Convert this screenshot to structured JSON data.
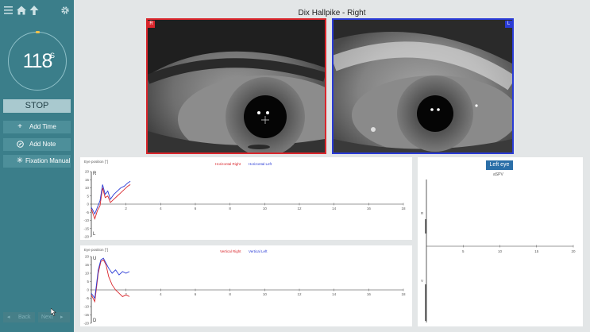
{
  "sidebar": {
    "icons": [
      "menu-icon",
      "home-icon",
      "upload-arrow-icon",
      "gear-icon"
    ],
    "timer": {
      "value": "118",
      "unit": "S"
    },
    "stop_label": "STOP",
    "buttons": [
      {
        "icon": "plus-icon",
        "label": "Add Time"
      },
      {
        "icon": "pencil-icon",
        "label": "Add Note"
      },
      {
        "icon": "fixation-icon",
        "label": "Fixation Manual"
      }
    ],
    "nav": {
      "back": "Back",
      "next": "Next"
    }
  },
  "header": {
    "title": "Dix Hallpike - Right"
  },
  "cameras": [
    {
      "label": "R",
      "border": "#d9262c"
    },
    {
      "label": "L",
      "border": "#2a3bd6"
    }
  ],
  "charts": {
    "ylabel": "Eye position [°]",
    "top_plot": {
      "legend": [
        "Horizontal Right",
        "Horizontal Left"
      ],
      "y_top_label": "R",
      "y_bottom_label": "L"
    },
    "bottom_plot": {
      "legend": [
        "Vertical Right",
        "Vertical Left"
      ],
      "y_top_label": "U",
      "y_bottom_label": "D"
    },
    "right_color": "#d9262c",
    "left_color": "#2a3bd6"
  },
  "spv": {
    "button": "Left eye",
    "title": "aSPV",
    "right_axis_top": "R",
    "right_axis_bottom": "V"
  },
  "chart_data": [
    {
      "type": "line",
      "xlim": [
        0,
        18
      ],
      "ylim": [
        -20,
        20
      ],
      "x_ticks": [
        2,
        4,
        6,
        8,
        10,
        12,
        14,
        16,
        18
      ],
      "y_ticks": [
        20,
        15,
        10,
        5,
        0,
        -5,
        -10,
        -15,
        -20
      ],
      "series": [
        {
          "name": "Horizontal Right",
          "x": [
            0,
            0.2,
            0.35,
            0.5,
            0.65,
            0.8,
            0.95,
            1.1,
            1.3,
            1.5,
            1.7,
            1.9,
            2.1,
            2.25
          ],
          "y": [
            -3,
            -9,
            -4,
            -1,
            10,
            4,
            5,
            1,
            3,
            5,
            7,
            9,
            11,
            12
          ]
        },
        {
          "name": "Horizontal Left",
          "x": [
            0,
            0.2,
            0.35,
            0.5,
            0.65,
            0.8,
            0.95,
            1.1,
            1.3,
            1.5,
            1.7,
            1.9,
            2.1,
            2.25
          ],
          "y": [
            -2,
            -6,
            -2,
            2,
            12,
            6,
            8,
            3,
            6,
            8,
            10,
            11,
            13,
            14
          ]
        }
      ]
    },
    {
      "type": "line",
      "xlim": [
        0,
        18
      ],
      "ylim": [
        -20,
        20
      ],
      "x_ticks": [
        2,
        4,
        6,
        8,
        10,
        12,
        14,
        16,
        18
      ],
      "y_ticks": [
        20,
        15,
        10,
        5,
        0,
        -5,
        -10,
        -15,
        -20
      ],
      "series": [
        {
          "name": "Vertical Right",
          "x": [
            0,
            0.2,
            0.4,
            0.55,
            0.7,
            0.85,
            1,
            1.2,
            1.4,
            1.6,
            1.8,
            2,
            2.2
          ],
          "y": [
            -3,
            -7,
            10,
            17,
            18,
            15,
            8,
            3,
            0,
            -2,
            -4,
            -3,
            -4
          ]
        },
        {
          "name": "Vertical Left",
          "x": [
            0,
            0.2,
            0.4,
            0.55,
            0.7,
            0.85,
            1,
            1.2,
            1.4,
            1.6,
            1.8,
            2,
            2.2
          ],
          "y": [
            -2,
            -5,
            12,
            18,
            19,
            16,
            13,
            10,
            12,
            9,
            11,
            10,
            11
          ]
        }
      ]
    },
    {
      "type": "scatter",
      "title": "aSPV",
      "x_ticks": [
        5,
        10,
        15,
        20
      ],
      "xlim": [
        0,
        20
      ],
      "series": []
    }
  ]
}
